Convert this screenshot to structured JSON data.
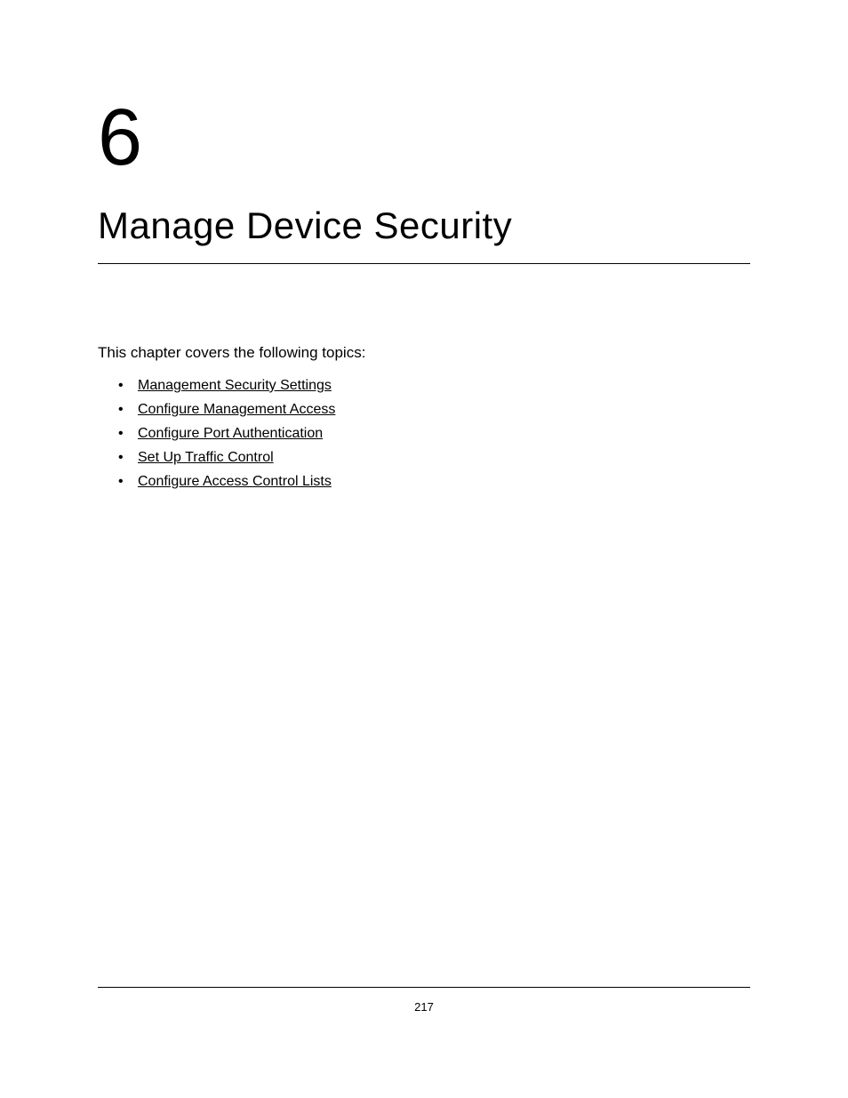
{
  "chapter": {
    "number": "6",
    "title": "Manage Device Security"
  },
  "intro": "This chapter covers the following topics:",
  "topics": [
    "Management Security Settings",
    "Configure Management Access",
    "Configure Port Authentication",
    "Set Up Traffic Control",
    "Configure Access Control Lists"
  ],
  "pageNumber": "217"
}
